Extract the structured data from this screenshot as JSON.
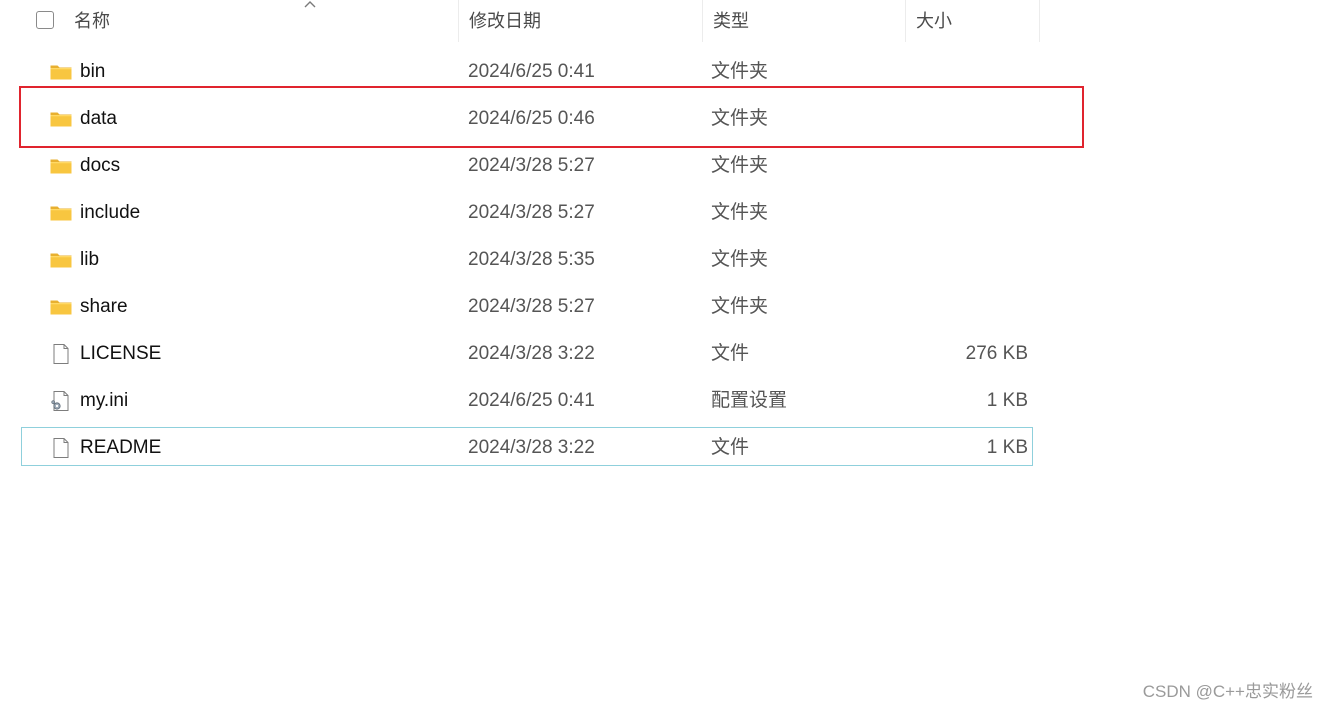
{
  "header": {
    "name_label": "名称",
    "date_label": "修改日期",
    "type_label": "类型",
    "size_label": "大小"
  },
  "files": [
    {
      "icon": "folder-icon",
      "name": "bin",
      "date": "2024/6/25 0:41",
      "type": "文件夹",
      "size": ""
    },
    {
      "icon": "folder-icon",
      "name": "data",
      "date": "2024/6/25 0:46",
      "type": "文件夹",
      "size": ""
    },
    {
      "icon": "folder-icon",
      "name": "docs",
      "date": "2024/3/28 5:27",
      "type": "文件夹",
      "size": ""
    },
    {
      "icon": "folder-icon",
      "name": "include",
      "date": "2024/3/28 5:27",
      "type": "文件夹",
      "size": ""
    },
    {
      "icon": "folder-icon",
      "name": "lib",
      "date": "2024/3/28 5:35",
      "type": "文件夹",
      "size": ""
    },
    {
      "icon": "folder-icon",
      "name": "share",
      "date": "2024/3/28 5:27",
      "type": "文件夹",
      "size": ""
    },
    {
      "icon": "file-icon",
      "name": "LICENSE",
      "date": "2024/3/28 3:22",
      "type": "文件",
      "size": "276 KB"
    },
    {
      "icon": "config-file-icon",
      "name": "my.ini",
      "date": "2024/6/25 0:41",
      "type": "配置设置",
      "size": "1 KB"
    },
    {
      "icon": "file-icon",
      "name": "README",
      "date": "2024/3/28 3:22",
      "type": "文件",
      "size": "1 KB"
    }
  ],
  "highlighted_row": "data",
  "focused_row": "README",
  "colors": {
    "highlight_border": "#e0242e",
    "focus_border": "#8fd0dc",
    "folder_yellow": "#f8c640"
  },
  "watermark": "CSDN @C++忠实粉丝"
}
